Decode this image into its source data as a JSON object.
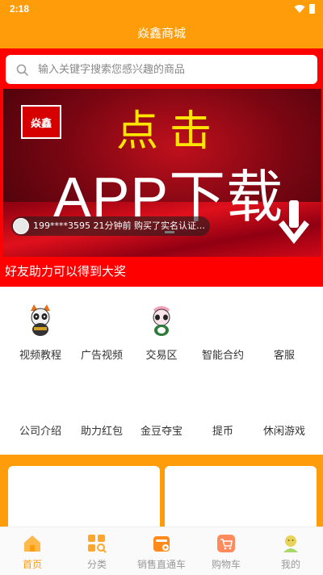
{
  "status": {
    "time": "2:18"
  },
  "header": {
    "title": "焱鑫商城"
  },
  "search": {
    "placeholder": "输入关键字搜索您感兴趣的商品"
  },
  "banner": {
    "logo_text": "焱鑫",
    "headline": "点击",
    "main_text": "APP下载",
    "notification": "199****3595 21分钟前 购买了实名认证…"
  },
  "promo": {
    "text": "好友助力可以得到大奖"
  },
  "grid": {
    "row1": [
      {
        "label": "视频教程",
        "icon": "panda-mascot-icon"
      },
      {
        "label": "广告视频",
        "icon": ""
      },
      {
        "label": "交易区",
        "icon": "pink-panda-mascot-icon"
      },
      {
        "label": "智能合约",
        "icon": ""
      },
      {
        "label": "客服",
        "icon": ""
      }
    ],
    "row2": [
      {
        "label": "公司介绍"
      },
      {
        "label": "助力红包"
      },
      {
        "label": "金豆夺宝"
      },
      {
        "label": "提币"
      },
      {
        "label": "休闲游戏"
      }
    ]
  },
  "tabs": [
    {
      "label": "首页",
      "icon": "home-icon",
      "active": true
    },
    {
      "label": "分类",
      "icon": "category-icon",
      "active": false
    },
    {
      "label": "销售直通车",
      "icon": "sales-icon",
      "active": false
    },
    {
      "label": "购物车",
      "icon": "cart-icon",
      "active": false
    },
    {
      "label": "我的",
      "icon": "profile-icon",
      "active": false
    }
  ],
  "colors": {
    "brand_orange": "#ff9c0a",
    "brand_red": "#ff0000"
  }
}
